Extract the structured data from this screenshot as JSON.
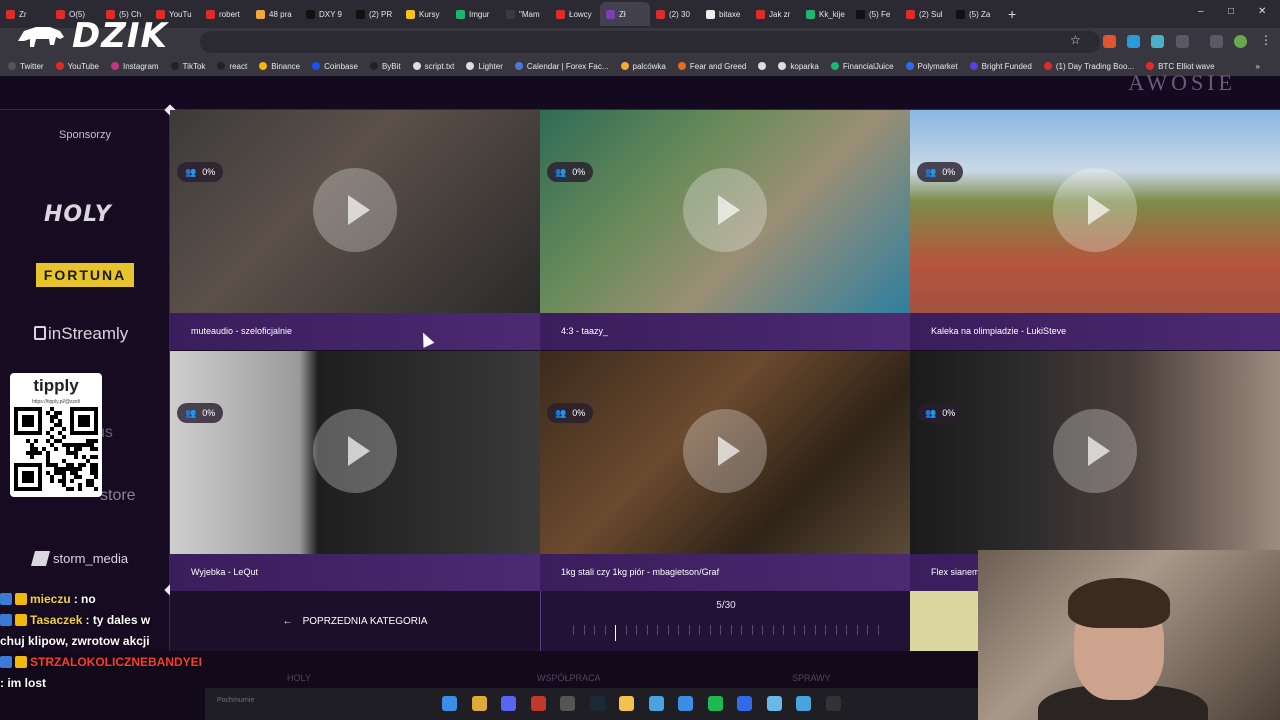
{
  "browser": {
    "tabs": [
      {
        "label": "Zr",
        "color": "#e02b2b"
      },
      {
        "label": "O(5)",
        "color": "#e02b2b"
      },
      {
        "label": "(5) Ch",
        "color": "#e02b2b"
      },
      {
        "label": "YouTu",
        "color": "#e02b2b"
      },
      {
        "label": "robert",
        "color": "#e02b2b"
      },
      {
        "label": "48 pra",
        "color": "#f2a93b"
      },
      {
        "label": "DXY 9",
        "color": "#111111"
      },
      {
        "label": "(2) PR",
        "color": "#111111"
      },
      {
        "label": "Kursy",
        "color": "#f5c518"
      },
      {
        "label": "Imgur",
        "color": "#1bb76e"
      },
      {
        "label": "\"Mam",
        "color": "#3a3a3a"
      },
      {
        "label": "Łowcy",
        "color": "#e02b2b"
      },
      {
        "label": "Zł",
        "color": "#7a3fb0"
      },
      {
        "label": "(2) 30",
        "color": "#e02b2b"
      },
      {
        "label": "bitaxe",
        "color": "#eeeeee"
      },
      {
        "label": "Jak zr",
        "color": "#e02b2b"
      },
      {
        "label": "Kk_kije",
        "color": "#1bb76e"
      },
      {
        "label": "(5) Fe",
        "color": "#111111"
      },
      {
        "label": "(2) Sul",
        "color": "#e02b2b"
      },
      {
        "label": "(5) Za",
        "color": "#111111"
      }
    ],
    "active_tab_index": 12,
    "new_tab_symbol": "+",
    "window_controls": [
      "–",
      "□",
      "✕"
    ],
    "bookmarks": [
      {
        "label": "Twitter",
        "color": "#555555"
      },
      {
        "label": "YouTube",
        "color": "#e02b2b"
      },
      {
        "label": "Instagram",
        "color": "#c13584"
      },
      {
        "label": "TikTok",
        "color": "#222222"
      },
      {
        "label": "react",
        "color": "#222222"
      },
      {
        "label": "Binance",
        "color": "#f0b90b"
      },
      {
        "label": "Coinbase",
        "color": "#1652f0"
      },
      {
        "label": "ByBit",
        "color": "#222222"
      },
      {
        "label": "script.txt",
        "color": "#dddddd"
      },
      {
        "label": "Lighter",
        "color": "#dddddd"
      },
      {
        "label": "Calendar | Forex Fac...",
        "color": "#4a7bd1"
      },
      {
        "label": "palcówka",
        "color": "#f2a93b"
      },
      {
        "label": "Fear and Greed",
        "color": "#e86a1f"
      },
      {
        "label": "",
        "color": "#dddddd"
      },
      {
        "label": "koparka",
        "color": "#dddddd"
      },
      {
        "label": "FinancialJuice",
        "color": "#1bb76e"
      },
      {
        "label": "Polymarket",
        "color": "#2f6be8"
      },
      {
        "label": "Bright Funded",
        "color": "#5a3fd8"
      },
      {
        "label": "(1) Day Trading Boo...",
        "color": "#e02b2b"
      },
      {
        "label": "BTC Elliot wave",
        "color": "#e02b2b"
      }
    ],
    "bookmarks_more": "»"
  },
  "page": {
    "top_word": "AWOSIE",
    "sponsors_title": "Sponsorzy",
    "sponsors": {
      "holy": "HOLY",
      "fortuna": "FORTUNA",
      "instreamly": "inStreamly",
      "ghost1": "us",
      "ghost2": "store",
      "storm": "storm_media"
    },
    "clips": [
      {
        "title": "muteaudio - szeloficjalnie",
        "viewers": "0%",
        "thumb": "linear-gradient(135deg,#3b3b3b,#5c5049 40%,#2a2a2a)"
      },
      {
        "title": "4:3 - taazy_",
        "viewers": "0%",
        "thumb": "linear-gradient(135deg,#2e6b55,#6a8b5a 35%,#9a8f74 60%,#2f7fa0)"
      },
      {
        "title": "Kaleka na olimpiadzie - LukiSteve",
        "viewers": "0%",
        "thumb": "linear-gradient(180deg,#8ab7e3 0%,#c9d8e6 30%,#7d8c4a 45%,#b5553c 75%,#a35240)"
      },
      {
        "title": "Wyjebka - LeQut",
        "viewers": "0%",
        "thumb": "linear-gradient(90deg,#cfcfcf 0%,#9a9a9a 35%,#1e1e1e 40%,#3a3a3a 100%)"
      },
      {
        "title": "1kg stali czy 1kg piór - mbagietson/Graf",
        "viewers": "0%",
        "thumb": "linear-gradient(135deg,#3b2a1d,#6b4a2e 40%,#2f2318 70%,#5a4a36)"
      },
      {
        "title": "Flex sianem - Grafyy",
        "viewers": "0%",
        "thumb": "linear-gradient(90deg,#1a1a1a 0%,#2b2b2b 30%,#4a3e3a 60%,#9c8c80 100%)"
      }
    ],
    "pager": {
      "prev_label": "POPRZEDNIA KATEGORIA",
      "prev_arrow": "←",
      "count": "5/30",
      "total": 30,
      "current": 5
    },
    "footer_ghost": [
      "HOLY",
      "WSPÓŁPRACA",
      "SPRAWY"
    ]
  },
  "overlay": {
    "brand": "DZIK",
    "qr_title": "tipply",
    "qr_url": "https://tipply.pl/@szeli",
    "chat": [
      {
        "user": "mieczu",
        "text": ": no",
        "color": "#f5d142"
      },
      {
        "user": "Tasaczek",
        "text": ": ty dales w",
        "color": "#f5d142"
      },
      {
        "user": "",
        "text": "chuj klipow, zwrotow akcji",
        "color": "#ffffff"
      },
      {
        "user": "STRZALOKOLICZNEBANDYEI",
        "text": "",
        "color": "#ff3b30"
      },
      {
        "user": "",
        "text": ": im lost",
        "color": "#ffffff"
      }
    ]
  },
  "taskbar": {
    "ghost": "Pochmurnie",
    "icons": [
      {
        "name": "windows-start-icon",
        "color": "#3b8ee8"
      },
      {
        "name": "chrome-icon",
        "color": "#e0a93a"
      },
      {
        "name": "discord-icon",
        "color": "#5865f2"
      },
      {
        "name": "app-icon",
        "color": "#c0392b"
      },
      {
        "name": "obs-icon",
        "color": "#555555"
      },
      {
        "name": "steam-icon",
        "color": "#1b2838"
      },
      {
        "name": "folder-icon",
        "color": "#f2c14e"
      },
      {
        "name": "ccleaner-icon",
        "color": "#4aa3df"
      },
      {
        "name": "network-icon",
        "color": "#3b8ee8"
      },
      {
        "name": "spotify-icon",
        "color": "#1db954"
      },
      {
        "name": "app2-icon",
        "color": "#2f6be8"
      },
      {
        "name": "notes-icon",
        "color": "#6bb8e8"
      },
      {
        "name": "photos-icon",
        "color": "#4aa3df"
      },
      {
        "name": "terminal-icon",
        "color": "#333333"
      }
    ]
  }
}
